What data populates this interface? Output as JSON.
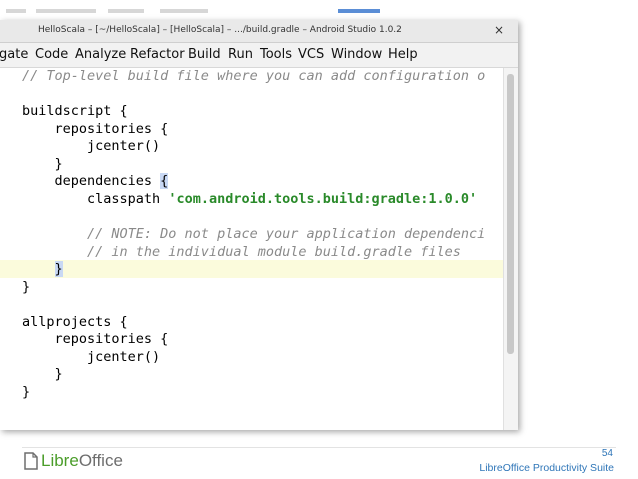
{
  "window": {
    "title": "HelloScala – [~/HelloScala] – [HelloScala] – .../build.gradle – Android Studio 1.0.2",
    "close_glyph": "×"
  },
  "menu": {
    "items": [
      "gate",
      "Code",
      "Analyze",
      "Refactor",
      "Build",
      "Run",
      "Tools",
      "VCS",
      "Window",
      "Help"
    ]
  },
  "code": {
    "lines": [
      "// Top-level build file where you can add configuration o",
      "",
      "buildscript {",
      "    repositories {",
      "        jcenter()",
      "    }",
      "    dependencies {",
      "        classpath 'com.android.tools.build:gradle:1.0.0'",
      "",
      "        // NOTE: Do not place your application dependenci",
      "        // in the individual module build.gradle files",
      "    }",
      "}",
      "",
      "allprojects {",
      "    repositories {",
      "        jcenter()",
      "    }",
      "}"
    ],
    "highlighted_line_index": 11
  },
  "footer": {
    "logo_text_1": "Libre",
    "logo_text_2": "Office",
    "page_number": "54",
    "suite_name": "LibreOffice Productivity Suite"
  },
  "colors": {
    "comment": "#8a8a8a",
    "string": "#2a8a2a",
    "current_line": "#fbfbdc",
    "brace_highlight": "#c8d8f4",
    "footer_blue": "#2f76b8",
    "logo_green": "#4b9d2a"
  }
}
